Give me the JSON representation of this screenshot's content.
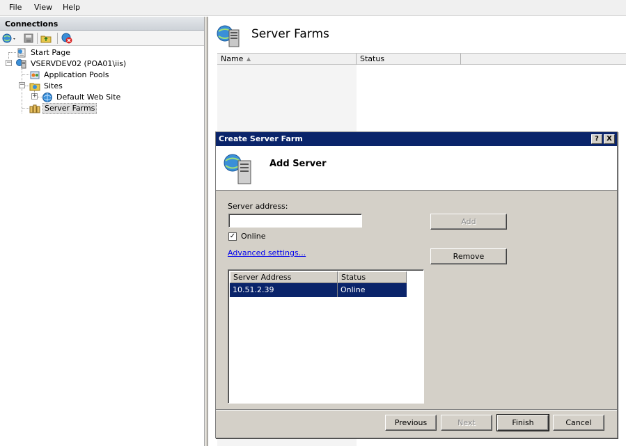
{
  "menu": {
    "file": "File",
    "view": "View",
    "help": "Help"
  },
  "connections": {
    "title": "Connections",
    "tree": {
      "start_page": "Start Page",
      "server": "VSERVDEV02 (POA01\\iis)",
      "app_pools": "Application Pools",
      "sites": "Sites",
      "default_site": "Default Web Site",
      "server_farms": "Server Farms"
    }
  },
  "main": {
    "title": "Server Farms",
    "columns": {
      "name": "Name",
      "status": "Status"
    }
  },
  "dialog": {
    "title": "Create Server Farm",
    "help_btn": "?",
    "close_btn": "X",
    "banner": "Add Server",
    "server_address_label": "Server address:",
    "server_address_value": "",
    "online_label": "Online",
    "online_checked": true,
    "advanced_link": "Advanced settings...",
    "add_btn": "Add",
    "remove_btn": "Remove",
    "list": {
      "col_address": "Server Address",
      "col_status": "Status",
      "rows": [
        {
          "address": "10.51.2.39",
          "status": "Online"
        }
      ]
    },
    "buttons": {
      "previous": "Previous",
      "next": "Next",
      "finish": "Finish",
      "cancel": "Cancel"
    }
  },
  "colors": {
    "titlebar": "#0a246a",
    "dialog_bg": "#d4d0c8",
    "link": "#0000ee"
  }
}
